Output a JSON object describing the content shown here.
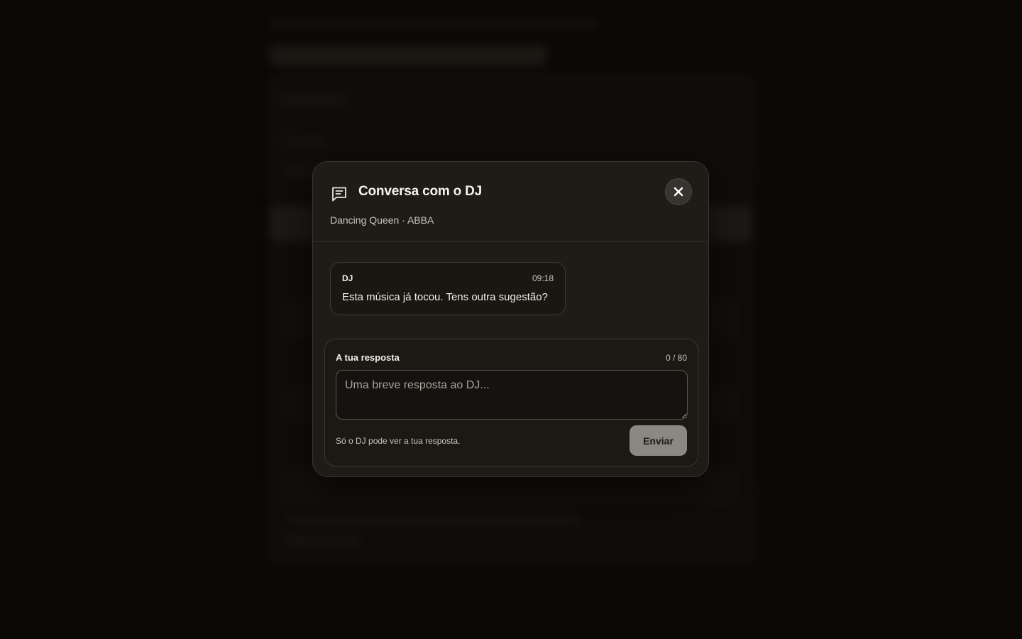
{
  "modal": {
    "title": "Conversa com o DJ",
    "subtitle": "Dancing Queen · ABBA",
    "icons": {
      "header": "chat-bubble-icon",
      "close": "close-icon"
    }
  },
  "messages": [
    {
      "sender": "DJ",
      "time": "09:18",
      "text": "Esta música já tocou. Tens outra sugestão?"
    }
  ],
  "reply": {
    "label": "A tua resposta",
    "counter": "0 / 80",
    "placeholder": "Uma breve resposta ao DJ...",
    "value": "",
    "hint": "Só o DJ pode ver a tua resposta.",
    "send_label": "Enviar"
  },
  "colors": {
    "modal_bg": "#1f1b16",
    "send_button": "#8b8782",
    "page_bg": "#0a0908"
  }
}
